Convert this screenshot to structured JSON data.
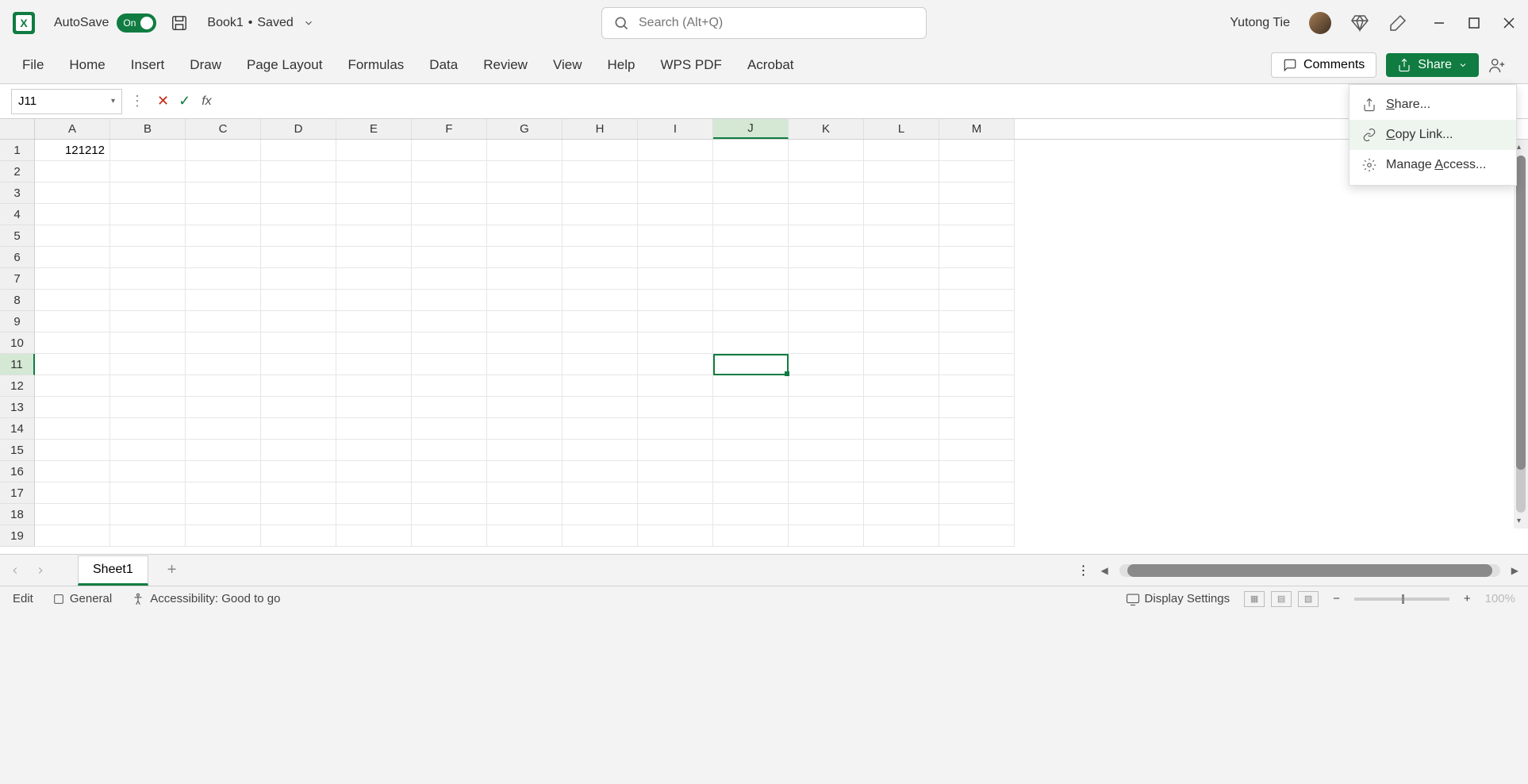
{
  "titlebar": {
    "autosave_label": "AutoSave",
    "autosave_state": "On",
    "doc_name": "Book1",
    "doc_status": "Saved",
    "search_placeholder": "Search (Alt+Q)",
    "username": "Yutong Tie"
  },
  "ribbon": {
    "tabs": [
      "File",
      "Home",
      "Insert",
      "Draw",
      "Page Layout",
      "Formulas",
      "Data",
      "Review",
      "View",
      "Help",
      "WPS PDF",
      "Acrobat"
    ],
    "comments_label": "Comments",
    "share_label": "Share"
  },
  "share_menu": {
    "share": "Share...",
    "copy_link": "Copy Link...",
    "manage": "Manage Access..."
  },
  "formula_bar": {
    "name_box": "J11",
    "formula": ""
  },
  "grid": {
    "columns": [
      "A",
      "B",
      "C",
      "D",
      "E",
      "F",
      "G",
      "H",
      "I",
      "J",
      "K",
      "L",
      "M"
    ],
    "rows": [
      1,
      2,
      3,
      4,
      5,
      6,
      7,
      8,
      9,
      10,
      11,
      12,
      13,
      14,
      15,
      16,
      17,
      18,
      19
    ],
    "selected_col": "J",
    "selected_row": 11,
    "cells": {
      "A1": "121212"
    }
  },
  "sheets": {
    "active": "Sheet1"
  },
  "status": {
    "mode": "Edit",
    "sensitivity": "General",
    "accessibility": "Accessibility: Good to go",
    "display_settings": "Display Settings",
    "zoom": "100%"
  }
}
